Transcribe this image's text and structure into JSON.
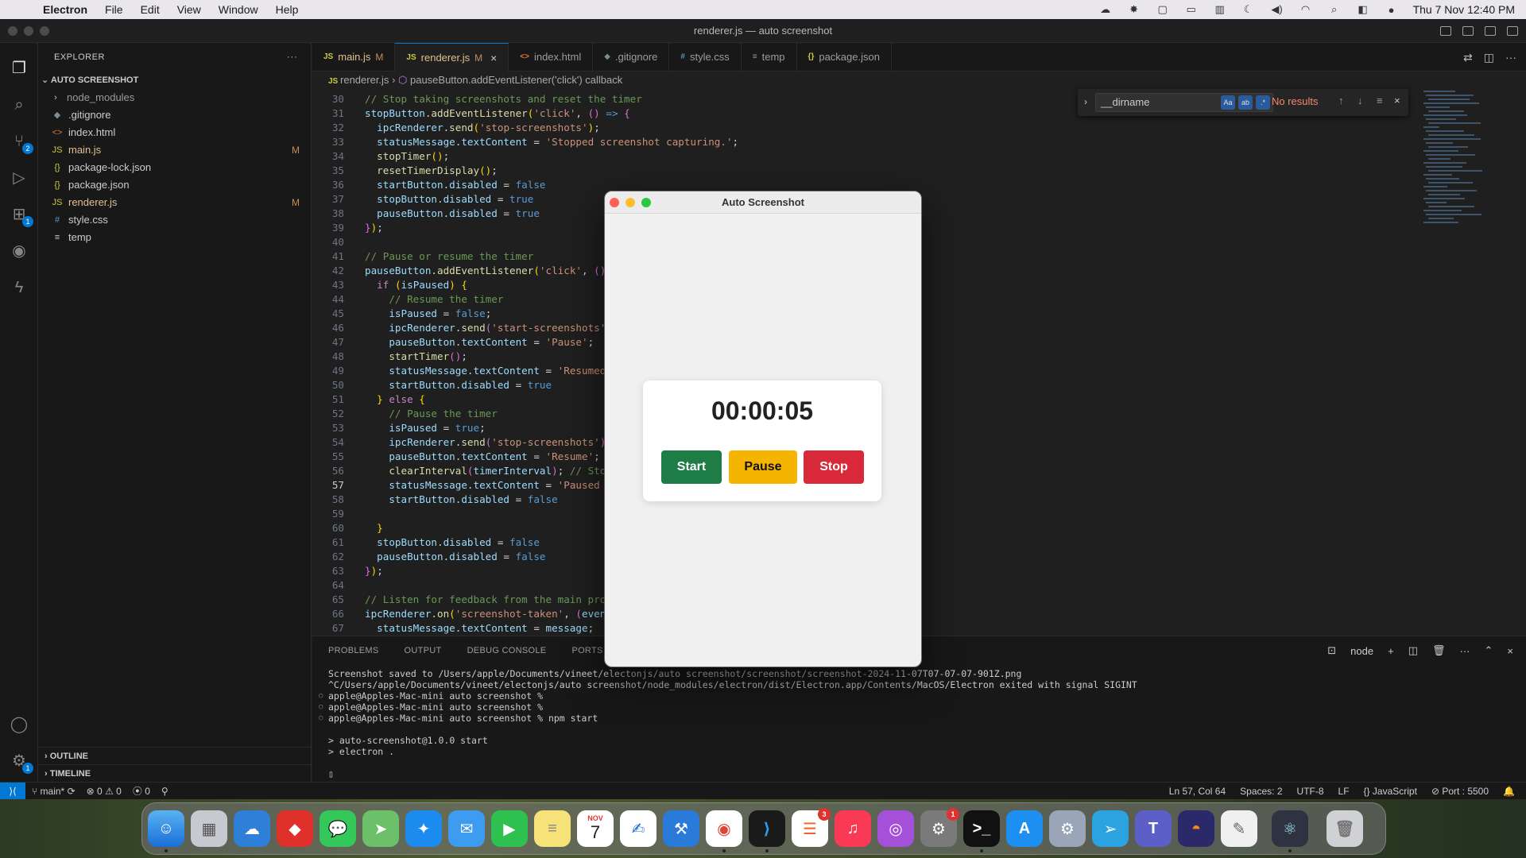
{
  "menubar": {
    "app_name": "Electron",
    "items": [
      "File",
      "Edit",
      "View",
      "Window",
      "Help"
    ],
    "datetime": "Thu 7 Nov  12:40 PM"
  },
  "window_title": "renderer.js — auto screenshot",
  "sidebar": {
    "title": "EXPLORER",
    "project": "AUTO SCREENSHOT",
    "files": [
      {
        "name": "node_modules",
        "icon": "›",
        "flag": ""
      },
      {
        "name": ".gitignore",
        "icon": "◆",
        "flag": ""
      },
      {
        "name": "index.html",
        "icon": "<>",
        "flag": ""
      },
      {
        "name": "main.js",
        "icon": "JS",
        "flag": "M"
      },
      {
        "name": "package-lock.json",
        "icon": "{}",
        "flag": ""
      },
      {
        "name": "package.json",
        "icon": "{}",
        "flag": ""
      },
      {
        "name": "renderer.js",
        "icon": "JS",
        "flag": "M"
      },
      {
        "name": "style.css",
        "icon": "#",
        "flag": ""
      },
      {
        "name": "temp",
        "icon": "≡",
        "flag": ""
      }
    ],
    "outline": "OUTLINE",
    "timeline": "TIMELINE"
  },
  "tabs": [
    {
      "label": "main.js",
      "icon": "JS",
      "flag": "M"
    },
    {
      "label": "renderer.js",
      "icon": "JS",
      "flag": "M"
    },
    {
      "label": "index.html",
      "icon": "<>",
      "flag": ""
    },
    {
      "label": ".gitignore",
      "icon": "◆",
      "flag": ""
    },
    {
      "label": "style.css",
      "icon": "#",
      "flag": ""
    },
    {
      "label": "temp",
      "icon": "≡",
      "flag": ""
    },
    {
      "label": "package.json",
      "icon": "{}",
      "flag": ""
    }
  ],
  "breadcrumb": {
    "file": "renderer.js",
    "symbol": "pauseButton.addEventListener('click') callback"
  },
  "find": {
    "query": "__dirname",
    "result": "No results",
    "opt_case": "Aa",
    "opt_word": "ab",
    "opt_regex": ".*"
  },
  "code": [
    {
      "n": "30",
      "indent": "",
      "t": [
        [
          "c-com",
          "// Stop taking screenshots and reset the timer"
        ]
      ]
    },
    {
      "n": "31",
      "indent": "",
      "t": [
        [
          "c-var",
          "stopButton"
        ],
        [
          "",
          "."
        ],
        [
          "c-fn",
          "addEventListener"
        ],
        [
          "c-br",
          "("
        ],
        [
          "c-str",
          "'click'"
        ],
        [
          "",
          ", "
        ],
        [
          "c-br2",
          "()"
        ],
        [
          "",
          " "
        ],
        [
          "c-kw",
          "=>"
        ],
        [
          "",
          " "
        ],
        [
          "c-br2",
          "{"
        ]
      ]
    },
    {
      "n": "32",
      "indent": "  ",
      "t": [
        [
          "c-var",
          "ipcRenderer"
        ],
        [
          "",
          "."
        ],
        [
          "c-fn",
          "send"
        ],
        [
          "c-br",
          "("
        ],
        [
          "c-str",
          "'stop-screenshots'"
        ],
        [
          "c-br",
          ")"
        ],
        [
          "",
          ";"
        ]
      ]
    },
    {
      "n": "33",
      "indent": "  ",
      "t": [
        [
          "c-var",
          "statusMessage"
        ],
        [
          "",
          "."
        ],
        [
          "c-var",
          "textContent"
        ],
        [
          "",
          " = "
        ],
        [
          "c-str",
          "'Stopped screenshot capturing.'"
        ],
        [
          "",
          ";"
        ]
      ]
    },
    {
      "n": "34",
      "indent": "  ",
      "t": [
        [
          "c-fn",
          "stopTimer"
        ],
        [
          "c-br",
          "()"
        ],
        [
          "",
          ";"
        ]
      ]
    },
    {
      "n": "35",
      "indent": "  ",
      "t": [
        [
          "c-fn",
          "resetTimerDisplay"
        ],
        [
          "c-br",
          "()"
        ],
        [
          "",
          ";"
        ]
      ]
    },
    {
      "n": "36",
      "indent": "  ",
      "t": [
        [
          "c-var",
          "startButton"
        ],
        [
          "",
          "."
        ],
        [
          "c-var",
          "disabled"
        ],
        [
          "",
          " = "
        ],
        [
          "c-kw",
          "false"
        ]
      ]
    },
    {
      "n": "37",
      "indent": "  ",
      "t": [
        [
          "c-var",
          "stopButton"
        ],
        [
          "",
          "."
        ],
        [
          "c-var",
          "disabled"
        ],
        [
          "",
          " = "
        ],
        [
          "c-kw",
          "true"
        ]
      ]
    },
    {
      "n": "38",
      "indent": "  ",
      "t": [
        [
          "c-var",
          "pauseButton"
        ],
        [
          "",
          "."
        ],
        [
          "c-var",
          "disabled"
        ],
        [
          "",
          " = "
        ],
        [
          "c-kw",
          "true"
        ]
      ]
    },
    {
      "n": "39",
      "indent": "",
      "t": [
        [
          "c-br2",
          "}"
        ],
        [
          "c-br",
          ")"
        ],
        [
          "",
          ";"
        ]
      ]
    },
    {
      "n": "40",
      "indent": "",
      "t": []
    },
    {
      "n": "41",
      "indent": "",
      "t": [
        [
          "c-com",
          "// Pause or resume the timer"
        ]
      ]
    },
    {
      "n": "42",
      "indent": "",
      "t": [
        [
          "c-var",
          "pauseButton"
        ],
        [
          "",
          "."
        ],
        [
          "c-fn",
          "addEventListener"
        ],
        [
          "c-br",
          "("
        ],
        [
          "c-str",
          "'click'"
        ],
        [
          "",
          ", "
        ],
        [
          "c-br2",
          "()"
        ],
        [
          "",
          " "
        ],
        [
          "c-kw",
          "=>"
        ],
        [
          "",
          " "
        ],
        [
          "c-br2",
          "{"
        ]
      ]
    },
    {
      "n": "43",
      "indent": "  ",
      "t": [
        [
          "c-kw2",
          "if"
        ],
        [
          "",
          " "
        ],
        [
          "c-br",
          "("
        ],
        [
          "c-var",
          "isPaused"
        ],
        [
          "c-br",
          ")"
        ],
        [
          "",
          " "
        ],
        [
          "c-br",
          "{"
        ]
      ]
    },
    {
      "n": "44",
      "indent": "    ",
      "t": [
        [
          "c-com",
          "// Resume the timer"
        ]
      ]
    },
    {
      "n": "45",
      "indent": "    ",
      "t": [
        [
          "c-var",
          "isPaused"
        ],
        [
          "",
          " = "
        ],
        [
          "c-kw",
          "false"
        ],
        [
          "",
          ";"
        ]
      ]
    },
    {
      "n": "46",
      "indent": "    ",
      "t": [
        [
          "c-var",
          "ipcRenderer"
        ],
        [
          "",
          "."
        ],
        [
          "c-fn",
          "send"
        ],
        [
          "c-br2",
          "("
        ],
        [
          "c-str",
          "'start-screenshots'"
        ],
        [
          "c-br2",
          ")"
        ],
        [
          "",
          ";"
        ]
      ]
    },
    {
      "n": "47",
      "indent": "    ",
      "t": [
        [
          "c-var",
          "pauseButton"
        ],
        [
          "",
          "."
        ],
        [
          "c-var",
          "textContent"
        ],
        [
          "",
          " = "
        ],
        [
          "c-str",
          "'Pause'"
        ],
        [
          "",
          ";"
        ]
      ]
    },
    {
      "n": "48",
      "indent": "    ",
      "t": [
        [
          "c-fn",
          "startTimer"
        ],
        [
          "c-br2",
          "()"
        ],
        [
          "",
          ";"
        ]
      ]
    },
    {
      "n": "49",
      "indent": "    ",
      "t": [
        [
          "c-var",
          "statusMessage"
        ],
        [
          "",
          "."
        ],
        [
          "c-var",
          "textContent"
        ],
        [
          "",
          " = "
        ],
        [
          "c-str",
          "'Resumed s"
        ]
      ]
    },
    {
      "n": "50",
      "indent": "    ",
      "t": [
        [
          "c-var",
          "startButton"
        ],
        [
          "",
          "."
        ],
        [
          "c-var",
          "disabled"
        ],
        [
          "",
          " = "
        ],
        [
          "c-kw",
          "true"
        ]
      ]
    },
    {
      "n": "51",
      "indent": "  ",
      "t": [
        [
          "c-br",
          "}"
        ],
        [
          "",
          " "
        ],
        [
          "c-kw2",
          "else"
        ],
        [
          "",
          " "
        ],
        [
          "c-br",
          "{"
        ]
      ]
    },
    {
      "n": "52",
      "indent": "    ",
      "t": [
        [
          "c-com",
          "// Pause the timer"
        ]
      ]
    },
    {
      "n": "53",
      "indent": "    ",
      "t": [
        [
          "c-var",
          "isPaused"
        ],
        [
          "",
          " = "
        ],
        [
          "c-kw",
          "true"
        ],
        [
          "",
          ";"
        ]
      ]
    },
    {
      "n": "54",
      "indent": "    ",
      "t": [
        [
          "c-var",
          "ipcRenderer"
        ],
        [
          "",
          "."
        ],
        [
          "c-fn",
          "send"
        ],
        [
          "c-br2",
          "("
        ],
        [
          "c-str",
          "'stop-screenshots'"
        ],
        [
          "c-br2",
          ")"
        ],
        [
          "",
          ";"
        ]
      ]
    },
    {
      "n": "55",
      "indent": "    ",
      "t": [
        [
          "c-var",
          "pauseButton"
        ],
        [
          "",
          "."
        ],
        [
          "c-var",
          "textContent"
        ],
        [
          "",
          " = "
        ],
        [
          "c-str",
          "'Resume'"
        ],
        [
          "",
          ";"
        ]
      ]
    },
    {
      "n": "56",
      "indent": "    ",
      "t": [
        [
          "c-fn",
          "clearInterval"
        ],
        [
          "c-br2",
          "("
        ],
        [
          "c-var",
          "timerInterval"
        ],
        [
          "c-br2",
          ")"
        ],
        [
          "",
          "; "
        ],
        [
          "c-com",
          "// Stop"
        ]
      ]
    },
    {
      "n": "57",
      "indent": "    ",
      "t": [
        [
          "c-var",
          "statusMessage"
        ],
        [
          "",
          "."
        ],
        [
          "c-var",
          "textContent"
        ],
        [
          "",
          " = "
        ],
        [
          "c-str",
          "'Paused sc"
        ]
      ]
    },
    {
      "n": "58",
      "indent": "    ",
      "t": [
        [
          "c-var",
          "startButton"
        ],
        [
          "",
          "."
        ],
        [
          "c-var",
          "disabled"
        ],
        [
          "",
          " = "
        ],
        [
          "c-kw",
          "false"
        ]
      ]
    },
    {
      "n": "59",
      "indent": "",
      "t": []
    },
    {
      "n": "60",
      "indent": "  ",
      "t": [
        [
          "c-br",
          "}"
        ]
      ]
    },
    {
      "n": "61",
      "indent": "  ",
      "t": [
        [
          "c-var",
          "stopButton"
        ],
        [
          "",
          "."
        ],
        [
          "c-var",
          "disabled"
        ],
        [
          "",
          " = "
        ],
        [
          "c-kw",
          "false"
        ]
      ]
    },
    {
      "n": "62",
      "indent": "  ",
      "t": [
        [
          "c-var",
          "pauseButton"
        ],
        [
          "",
          "."
        ],
        [
          "c-var",
          "disabled"
        ],
        [
          "",
          " = "
        ],
        [
          "c-kw",
          "false"
        ]
      ]
    },
    {
      "n": "63",
      "indent": "",
      "t": [
        [
          "c-br2",
          "}"
        ],
        [
          "c-br",
          ")"
        ],
        [
          "",
          ";"
        ]
      ]
    },
    {
      "n": "64",
      "indent": "",
      "t": []
    },
    {
      "n": "65",
      "indent": "",
      "t": [
        [
          "c-com",
          "// Listen for feedback from the main proce"
        ]
      ]
    },
    {
      "n": "66",
      "indent": "",
      "t": [
        [
          "c-var",
          "ipcRenderer"
        ],
        [
          "",
          "."
        ],
        [
          "c-fn",
          "on"
        ],
        [
          "c-br",
          "("
        ],
        [
          "c-str",
          "'screenshot-taken'"
        ],
        [
          "",
          ", "
        ],
        [
          "c-br2",
          "("
        ],
        [
          "c-var",
          "event"
        ],
        [
          "",
          ","
        ]
      ]
    },
    {
      "n": "67",
      "indent": "  ",
      "t": [
        [
          "c-var",
          "statusMessage"
        ],
        [
          "",
          "."
        ],
        [
          "c-var",
          "textContent"
        ],
        [
          "",
          " = "
        ],
        [
          "c-var",
          "message"
        ],
        [
          "",
          ";"
        ]
      ]
    }
  ],
  "active_line": "57",
  "panel": {
    "tabs": [
      "PROBLEMS",
      "OUTPUT",
      "DEBUG CONSOLE",
      "PORTS",
      "TE"
    ],
    "shell": "node",
    "terminal": [
      {
        "text": "Screenshot saved to /Users/apple/Documents/vineet/electonjs/auto screenshot/screenshot/screenshot-2024-11-07T07-07-07-901Z.png",
        "dot": ""
      },
      {
        "text": "^C/Users/apple/Documents/vineet/electonjs/auto screenshot/node_modules/electron/dist/Electron.app/Contents/MacOS/Electron exited with signal SIGINT",
        "dot": ""
      },
      {
        "text": "apple@Apples-Mac-mini auto screenshot %",
        "dot": "○"
      },
      {
        "text": "apple@Apples-Mac-mini auto screenshot %",
        "dot": "○"
      },
      {
        "text": "apple@Apples-Mac-mini auto screenshot % npm start",
        "dot": "○"
      },
      {
        "text": "",
        "dot": ""
      },
      {
        "text": "> auto-screenshot@1.0.0 start",
        "dot": ""
      },
      {
        "text": "> electron .",
        "dot": ""
      },
      {
        "text": "",
        "dot": ""
      },
      {
        "text": "▯",
        "dot": ""
      }
    ]
  },
  "statusbar": {
    "branch": "main*",
    "errors": "0",
    "warnings": "0",
    "ports": "0",
    "position": "Ln 57, Col 64",
    "spaces": "Spaces: 2",
    "encoding": "UTF-8",
    "eol": "LF",
    "language": "JavaScript",
    "port": "Port : 5500"
  },
  "app": {
    "title": "Auto Screenshot",
    "timer": "00:00:05",
    "start": "Start",
    "pause": "Pause",
    "stop": "Stop"
  },
  "dock": {
    "calendar_month": "NOV",
    "calendar_day": "7",
    "reminders_badge": "3",
    "settings_badge": "1"
  },
  "activity": {
    "scm_badge": "2",
    "ext_badge": "1",
    "settings_badge": "1"
  }
}
